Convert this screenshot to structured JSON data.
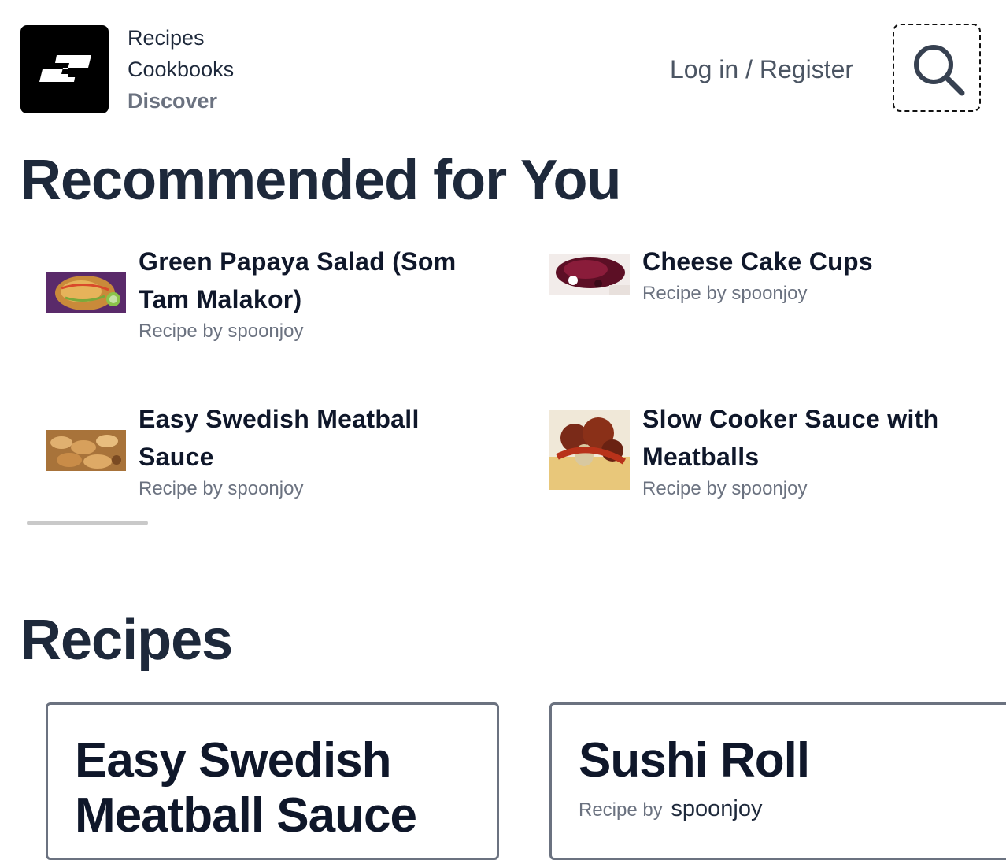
{
  "header": {
    "nav": [
      "Recipes",
      "Cookbooks",
      "Discover"
    ],
    "login_label": "Log in / Register"
  },
  "recommended": {
    "title": "Recommended for You",
    "items": [
      {
        "name": "Green Papaya Salad (Som Tam Malakor)",
        "byline": "Recipe by spoonjoy"
      },
      {
        "name": "Cheese Cake Cups",
        "byline": "Recipe by spoonjoy"
      },
      {
        "name": "Easy Swedish Meatball Sauce",
        "byline": "Recipe by spoonjoy"
      },
      {
        "name": "Slow Cooker Sauce with Meatballs",
        "byline": "Recipe by spoonjoy"
      }
    ]
  },
  "recipes": {
    "title": "Recipes",
    "cards": [
      {
        "title": "Easy Swedish Meatball Sauce",
        "by_label": "",
        "author": ""
      },
      {
        "title": "Sushi Roll",
        "by_label": "Recipe by",
        "author": "spoonjoy"
      }
    ]
  },
  "colors": {
    "text": "#1e293b",
    "muted": "#6b7280",
    "logo_bg": "#000000"
  },
  "icons": [
    "spoonjoy-logo",
    "search-icon"
  ]
}
